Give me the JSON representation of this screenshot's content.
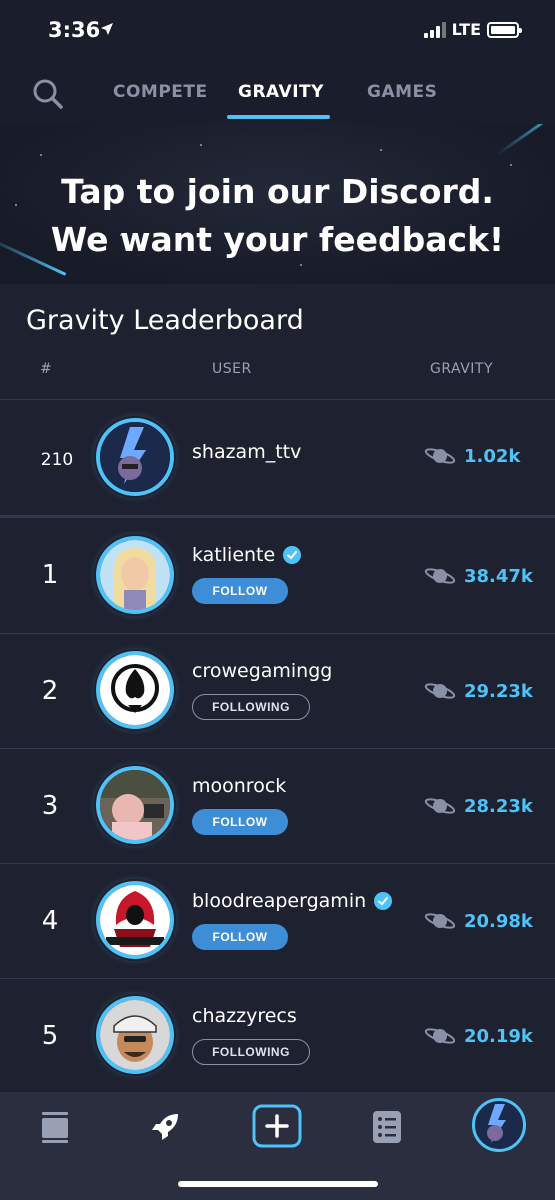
{
  "status": {
    "time": "3:36",
    "network": "LTE"
  },
  "tabs": [
    {
      "label": "COMPETE",
      "active": false
    },
    {
      "label": "GRAVITY",
      "active": true
    },
    {
      "label": "GAMES",
      "active": false
    }
  ],
  "banner": {
    "line1": "Tap to join our Discord.",
    "line2": "We want your feedback!"
  },
  "leaderboard": {
    "title": "Gravity Leaderboard",
    "headers": {
      "rank": "#",
      "user": "USER",
      "gravity": "GRAVITY"
    },
    "current_user": {
      "rank": "210",
      "username": "shazam_ttv",
      "gravity": "1.02k"
    },
    "rows": [
      {
        "rank": "1",
        "username": "katliente",
        "verified": true,
        "button": "FOLLOW",
        "gravity": "38.47k"
      },
      {
        "rank": "2",
        "username": "crowegamingg",
        "verified": false,
        "button": "FOLLOWING",
        "gravity": "29.23k"
      },
      {
        "rank": "3",
        "username": "moonrock",
        "verified": false,
        "button": "FOLLOW",
        "gravity": "28.23k"
      },
      {
        "rank": "4",
        "username": "bloodreapergamin",
        "verified": true,
        "button": "FOLLOW",
        "gravity": "20.98k"
      },
      {
        "rank": "5",
        "username": "chazzyrecs",
        "verified": false,
        "button": "FOLLOWING",
        "gravity": "20.19k"
      }
    ]
  },
  "bottom_nav": [
    "feed-icon",
    "rocket-icon",
    "add-icon",
    "list-icon",
    "profile-avatar"
  ],
  "colors": {
    "accent": "#4fc3f7",
    "follow_button": "#3d8ed6",
    "background": "#1e2130"
  }
}
